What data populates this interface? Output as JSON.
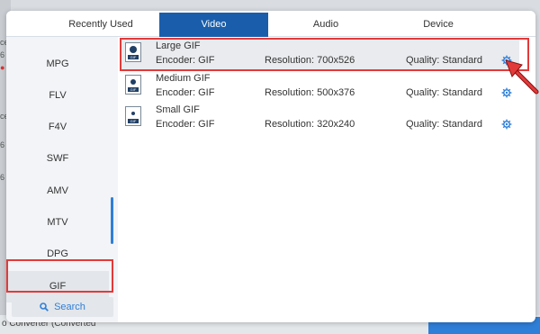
{
  "background": {
    "fragments": [
      "ce",
      "6",
      "ce",
      "6",
      "6"
    ],
    "bottom_text": "o Converter (Converted"
  },
  "tabs": [
    {
      "label": "Recently Used",
      "active": false
    },
    {
      "label": "Video",
      "active": true
    },
    {
      "label": "Audio",
      "active": false
    },
    {
      "label": "Device",
      "active": false
    }
  ],
  "formats": [
    {
      "label": "MPG",
      "selected": false
    },
    {
      "label": "FLV",
      "selected": false
    },
    {
      "label": "F4V",
      "selected": false
    },
    {
      "label": "SWF",
      "selected": false
    },
    {
      "label": "AMV",
      "selected": false
    },
    {
      "label": "MTV",
      "selected": false
    },
    {
      "label": "DPG",
      "selected": false
    },
    {
      "label": "GIF",
      "selected": true
    }
  ],
  "search": {
    "label": "Search",
    "icon": "search-icon"
  },
  "presets": [
    {
      "name": "Large GIF",
      "encoder": "Encoder: GIF",
      "resolution": "Resolution: 700x526",
      "quality": "Quality: Standard",
      "icon": "gif-file-icon",
      "selected": true
    },
    {
      "name": "Medium GIF",
      "encoder": "Encoder: GIF",
      "resolution": "Resolution: 500x376",
      "quality": "Quality: Standard",
      "icon": "gif-file-icon",
      "selected": false
    },
    {
      "name": "Small GIF",
      "encoder": "Encoder: GIF",
      "resolution": "Resolution: 320x240",
      "quality": "Quality: Standard",
      "icon": "gif-file-icon",
      "selected": false
    }
  ],
  "colors": {
    "accent": "#1a5eab",
    "highlight": "#e23a3a",
    "link": "#2f7fd8"
  }
}
